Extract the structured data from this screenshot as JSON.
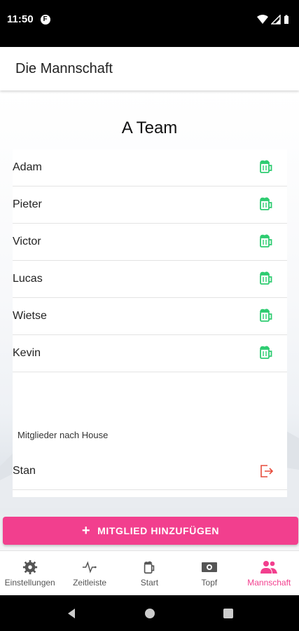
{
  "status": {
    "time": "11:50",
    "notif_glyph": "F"
  },
  "appbar": {
    "title": "Die Mannschaft"
  },
  "team": {
    "name": "A Team"
  },
  "members": [
    {
      "name": "Adam",
      "icon": "beer-mug-icon"
    },
    {
      "name": "Pieter",
      "icon": "beer-mug-icon"
    },
    {
      "name": "Victor",
      "icon": "beer-mug-icon"
    },
    {
      "name": "Lucas",
      "icon": "beer-mug-icon"
    },
    {
      "name": "Wietse",
      "icon": "beer-mug-icon"
    },
    {
      "name": "Kevin",
      "icon": "beer-mug-icon"
    }
  ],
  "home_section": {
    "label": "Mitglieder nach House",
    "members": [
      {
        "name": "Stan",
        "icon": "logout-icon"
      }
    ]
  },
  "add_button": {
    "label": "MITGLIED HINZUFÜGEN"
  },
  "nav": {
    "items": [
      {
        "label": "Einstellungen",
        "icon": "gear-icon"
      },
      {
        "label": "Zeitleiste",
        "icon": "pulse-icon"
      },
      {
        "label": "Start",
        "icon": "beer-mug-icon"
      },
      {
        "label": "Topf",
        "icon": "money-icon"
      },
      {
        "label": "Mannschaft",
        "icon": "people-icon"
      }
    ],
    "active": "Mannschaft"
  },
  "colors": {
    "accent": "#f23f8e",
    "beer_icon": "#2ecc71",
    "logout_icon": "#e74c3c"
  }
}
